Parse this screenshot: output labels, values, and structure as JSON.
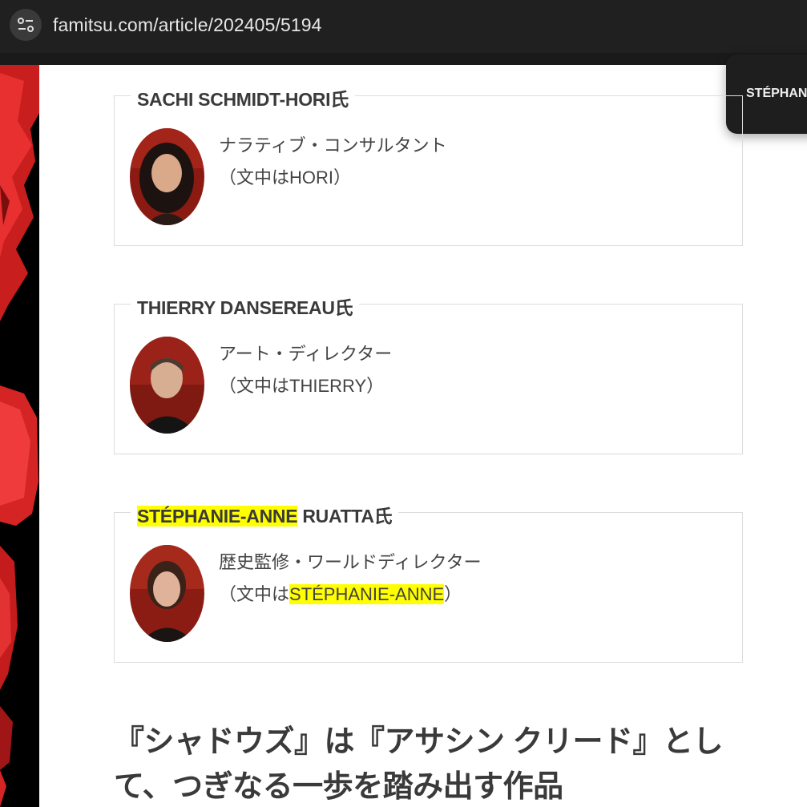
{
  "browser": {
    "url": "famitsu.com/article/202405/5194"
  },
  "popup": {
    "text": "STÉPHANIE"
  },
  "profiles": [
    {
      "name": "SACHI SCHMIDT-HORI氏",
      "role": "ナラティブ・コンサルタント",
      "note": "（文中はHORI）"
    },
    {
      "name": "THIERRY DANSEREAU氏",
      "role": "アート・ディレクター",
      "note": "（文中はTHIERRY）"
    },
    {
      "name_highlight": "STÉPHANIE-ANNE",
      "name_rest": " RUATTA氏",
      "role": "歴史監修・ワールドディレクター",
      "note_pre": "（文中は",
      "note_highlight": "STÉPHANIE-ANNE",
      "note_post": "）"
    }
  ],
  "article": {
    "heading": "『シャドウズ』は『アサシン クリード』として、つぎなる一歩を踏み出す作品"
  },
  "colors": {
    "highlight": "#ffff00",
    "topbar": "#202020",
    "side_art": "#d42020"
  }
}
